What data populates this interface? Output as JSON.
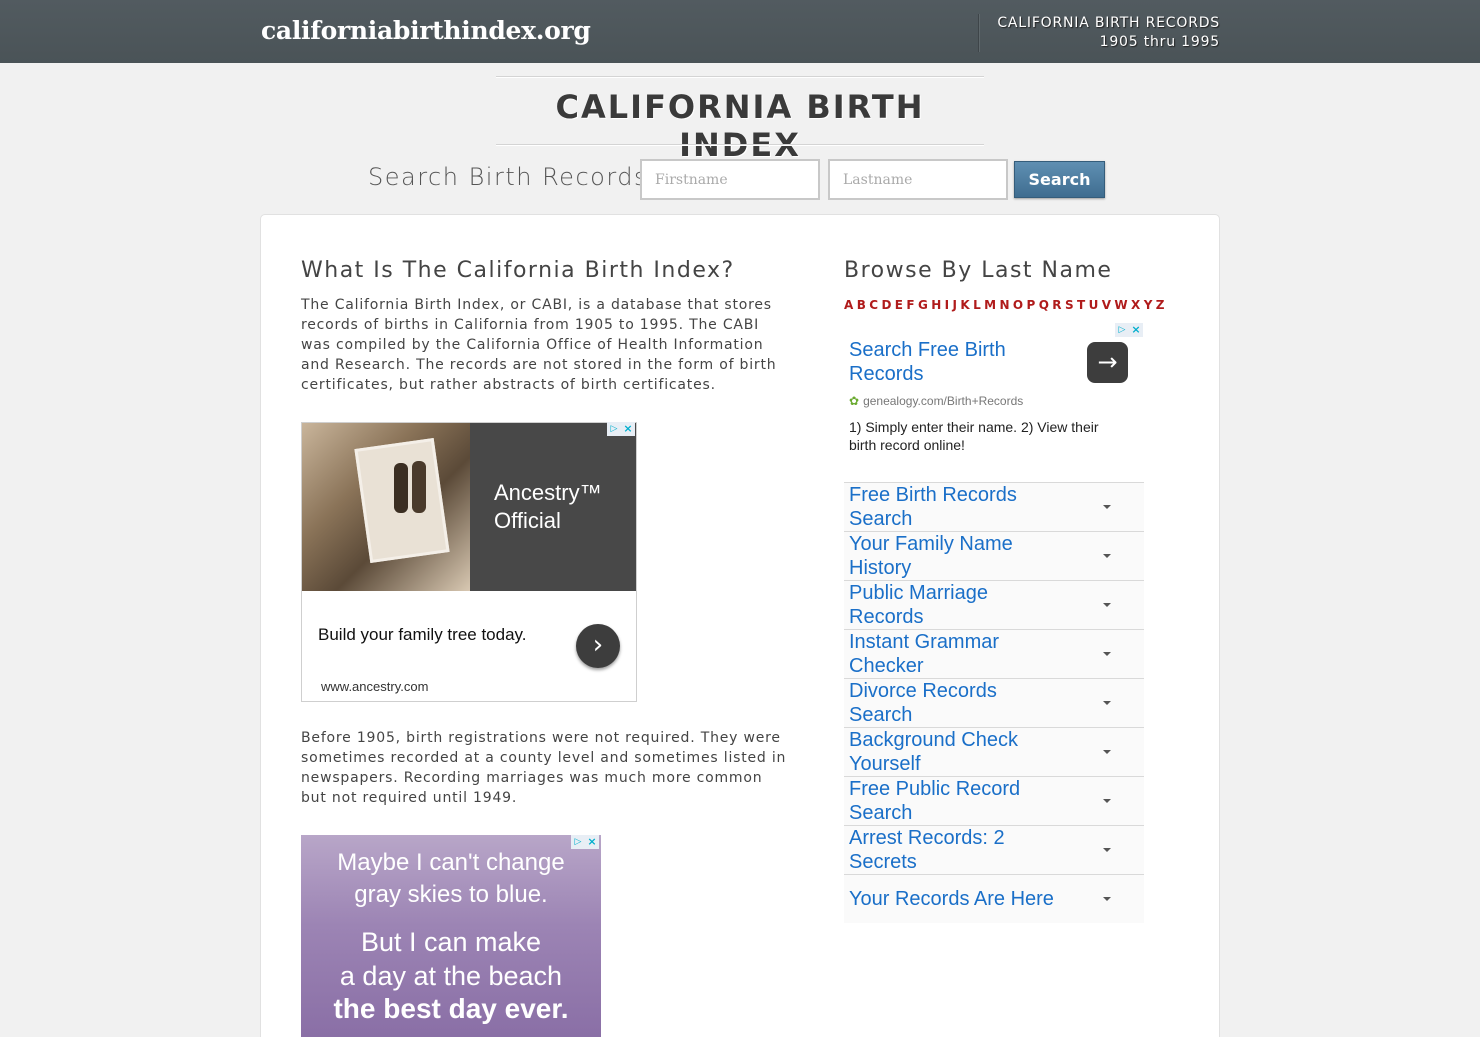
{
  "header": {
    "site_name": "californiabirthindex.org",
    "right_line1": "CALIFORNIA BIRTH RECORDS",
    "right_line2": "1905 thru 1995"
  },
  "title": "CALIFORNIA BIRTH INDEX",
  "search": {
    "label": "Search Birth Records:",
    "firstname_placeholder": "Firstname",
    "lastname_placeholder": "Lastname",
    "button": "Search"
  },
  "left": {
    "heading": "What Is The California Birth Index?",
    "para1": "The California Birth Index, or CABI, is a database that stores records of births in California from 1905 to 1995. The CABI was compiled by the California Office of Health Information and Research. The records are not stored in the form of birth certificates, but rather abstracts of birth certificates.",
    "para2": "Before 1905, birth registrations were not required. They were sometimes recorded at a county level and sometimes listed in newspapers. Recording marriages was much more common but not required until 1949."
  },
  "ad_ancestry": {
    "title_line1": "Ancestry™",
    "title_line2": "Official",
    "tagline": "Build your family tree today.",
    "url": "www.ancestry.com"
  },
  "ad_sky": {
    "line1": "Maybe I can't change",
    "line2": "gray skies to blue.",
    "line3": "But I can make",
    "line4": "a day at the beach",
    "line5": "the best day ever."
  },
  "right": {
    "heading": "Browse By Last Name",
    "letters": [
      "A",
      "B",
      "C",
      "D",
      "E",
      "F",
      "G",
      "H",
      "I",
      "J",
      "K",
      "L",
      "M",
      "N",
      "O",
      "P",
      "Q",
      "R",
      "S",
      "T",
      "U",
      "V",
      "W",
      "X",
      "Y",
      "Z"
    ]
  },
  "ad_genealogy": {
    "headline": "Search Free Birth Records",
    "url": "genealogy.com/Birth+Records",
    "description": "1) Simply enter their name. 2) View their birth record online!"
  },
  "ad_links": [
    "Free Birth Records Search",
    "Your Family Name History",
    "Public Marriage Records",
    "Instant Grammar Checker",
    "Divorce Records Search",
    "Background Check Yourself",
    "Free Public Record Search",
    "Arrest Records: 2 Secrets",
    "Your Records Are Here"
  ],
  "icons": {
    "ad_choices": "ad-choices-icon",
    "ad_close": "close-icon",
    "arrow_right": "arrow-right-icon",
    "chevron_right": "chevron-right-icon",
    "caret_down": "caret-down-icon"
  },
  "colors": {
    "topbar": "#4f585c",
    "link_blue": "#1a6fc8",
    "alpha_red": "#b01b1b",
    "search_button": "#4f7fa3"
  }
}
